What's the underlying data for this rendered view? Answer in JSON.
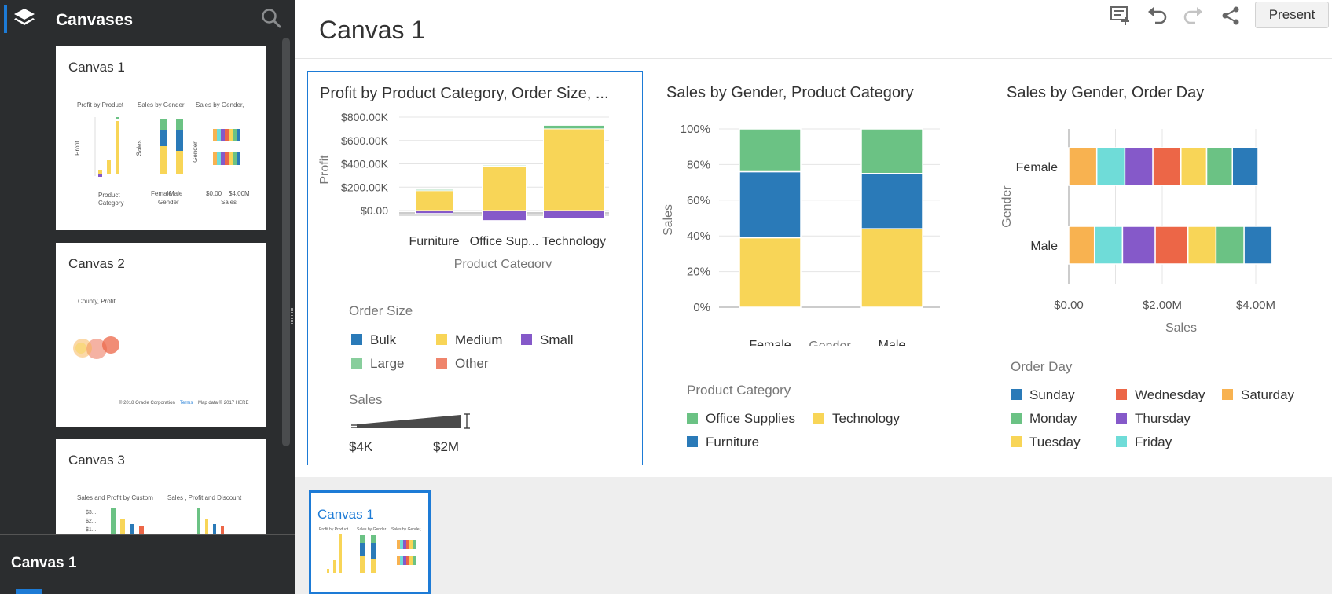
{
  "sidebar": {
    "title": "Canvases",
    "current_canvas": "Canvas 1",
    "canvases": [
      {
        "name": "Canvas 1",
        "mini_labels": [
          "Profit by Product",
          "Sales by Gender",
          "Sales by Gender,",
          "Product",
          "Category",
          "Female",
          "Male",
          "Gender",
          "$0.00",
          "$4.00M",
          "Sales",
          "Profit",
          "Sales",
          "Gender"
        ]
      },
      {
        "name": "Canvas 2",
        "mini_labels": [
          "County, Profit",
          "© 2018 Oracle Corporation",
          "Terms",
          "Map data © 2017 HERE"
        ]
      },
      {
        "name": "Canvas 3",
        "mini_labels": [
          "Sales and Profit by Custom",
          "Sales , Profit and Discount",
          "$3...",
          "$2...",
          "$1..."
        ]
      }
    ]
  },
  "header": {
    "page_title": "Canvas 1",
    "present_label": "Present"
  },
  "icons": {
    "layers": "layers-icon",
    "search": "search-icon",
    "add_canvas": "add-comment-icon",
    "undo": "undo-icon",
    "redo": "redo-icon",
    "share": "share-icon"
  },
  "colors": {
    "accent": "#1d7bd6",
    "blue": "#2a7ab8",
    "yellow": "#f8d557",
    "green": "#6bc284",
    "purple": "#8559c9",
    "red": "#ec6647",
    "orange": "#f8b250",
    "cyan": "#6fdcd8"
  },
  "viz1": {
    "title": "Profit by Product Category, Order Size, ...",
    "ylabel": "Profit",
    "xlabel": "Product Category",
    "y_ticks": [
      "$800.00K",
      "$600.00K",
      "$400.00K",
      "$200.00K",
      "$0.00"
    ],
    "categories": [
      "Furniture",
      "Office Sup...",
      "Technology"
    ],
    "legend_title": "Order Size",
    "legend": [
      "Bulk",
      "Medium",
      "Small",
      "Large",
      "Other"
    ],
    "size_legend_title": "Sales",
    "size_min": "$4K",
    "size_max": "$2M"
  },
  "viz2": {
    "title": "Sales by Gender, Product Category",
    "ylabel": "Sales",
    "xlabel": "Gender",
    "y_ticks": [
      "100%",
      "80%",
      "60%",
      "40%",
      "20%",
      "0%"
    ],
    "categories": [
      "Female",
      "Male"
    ],
    "legend_title": "Product Category",
    "legend": [
      "Office Supplies",
      "Technology",
      "Furniture"
    ]
  },
  "viz3": {
    "title": "Sales by Gender, Order Day",
    "ylabel": "Gender",
    "xlabel": "Sales",
    "categories": [
      "Female",
      "Male"
    ],
    "x_ticks": [
      "$0.00",
      "$2.00M",
      "$4.00M"
    ],
    "legend_title": "Order Day",
    "legend": [
      "Sunday",
      "Wednesday",
      "Saturday",
      "Monday",
      "Thursday",
      "Tuesday",
      "Friday"
    ]
  },
  "chart_data": [
    {
      "type": "bar",
      "title": "Profit by Product Category, Order Size, ...",
      "xlabel": "Product Category",
      "ylabel": "Profit",
      "categories": [
        "Furniture",
        "Office Sup...",
        "Technology"
      ],
      "ylim": [
        -50000,
        850000
      ],
      "stacked": true,
      "series": [
        {
          "name": "Medium",
          "values": [
            170000,
            380000,
            700000
          ]
        },
        {
          "name": "Large",
          "values": [
            10000,
            8000,
            30000
          ]
        },
        {
          "name": "Small",
          "values": [
            -25000,
            -85000,
            -70000
          ]
        }
      ]
    },
    {
      "type": "bar",
      "title": "Sales by Gender, Product Category",
      "xlabel": "Gender",
      "ylabel": "Sales",
      "categories": [
        "Female",
        "Male"
      ],
      "ylim": [
        0,
        100
      ],
      "stacked": true,
      "series": [
        {
          "name": "Technology",
          "values": [
            39,
            44
          ]
        },
        {
          "name": "Furniture",
          "values": [
            37,
            31
          ]
        },
        {
          "name": "Office Supplies",
          "values": [
            24,
            25
          ]
        }
      ]
    },
    {
      "type": "bar",
      "orientation": "horizontal",
      "title": "Sales by Gender, Order Day",
      "xlabel": "Sales",
      "ylabel": "Gender",
      "categories": [
        "Female",
        "Male"
      ],
      "xlim": [
        0,
        4500000
      ],
      "stacked": true,
      "series": [
        {
          "name": "Saturday",
          "values": [
            600000,
            550000
          ]
        },
        {
          "name": "Friday",
          "values": [
            600000,
            600000
          ]
        },
        {
          "name": "Thursday",
          "values": [
            600000,
            700000
          ]
        },
        {
          "name": "Wednesday",
          "values": [
            600000,
            700000
          ]
        },
        {
          "name": "Tuesday",
          "values": [
            550000,
            600000
          ]
        },
        {
          "name": "Monday",
          "values": [
            550000,
            600000
          ]
        },
        {
          "name": "Sunday",
          "values": [
            550000,
            600000
          ]
        }
      ]
    }
  ]
}
